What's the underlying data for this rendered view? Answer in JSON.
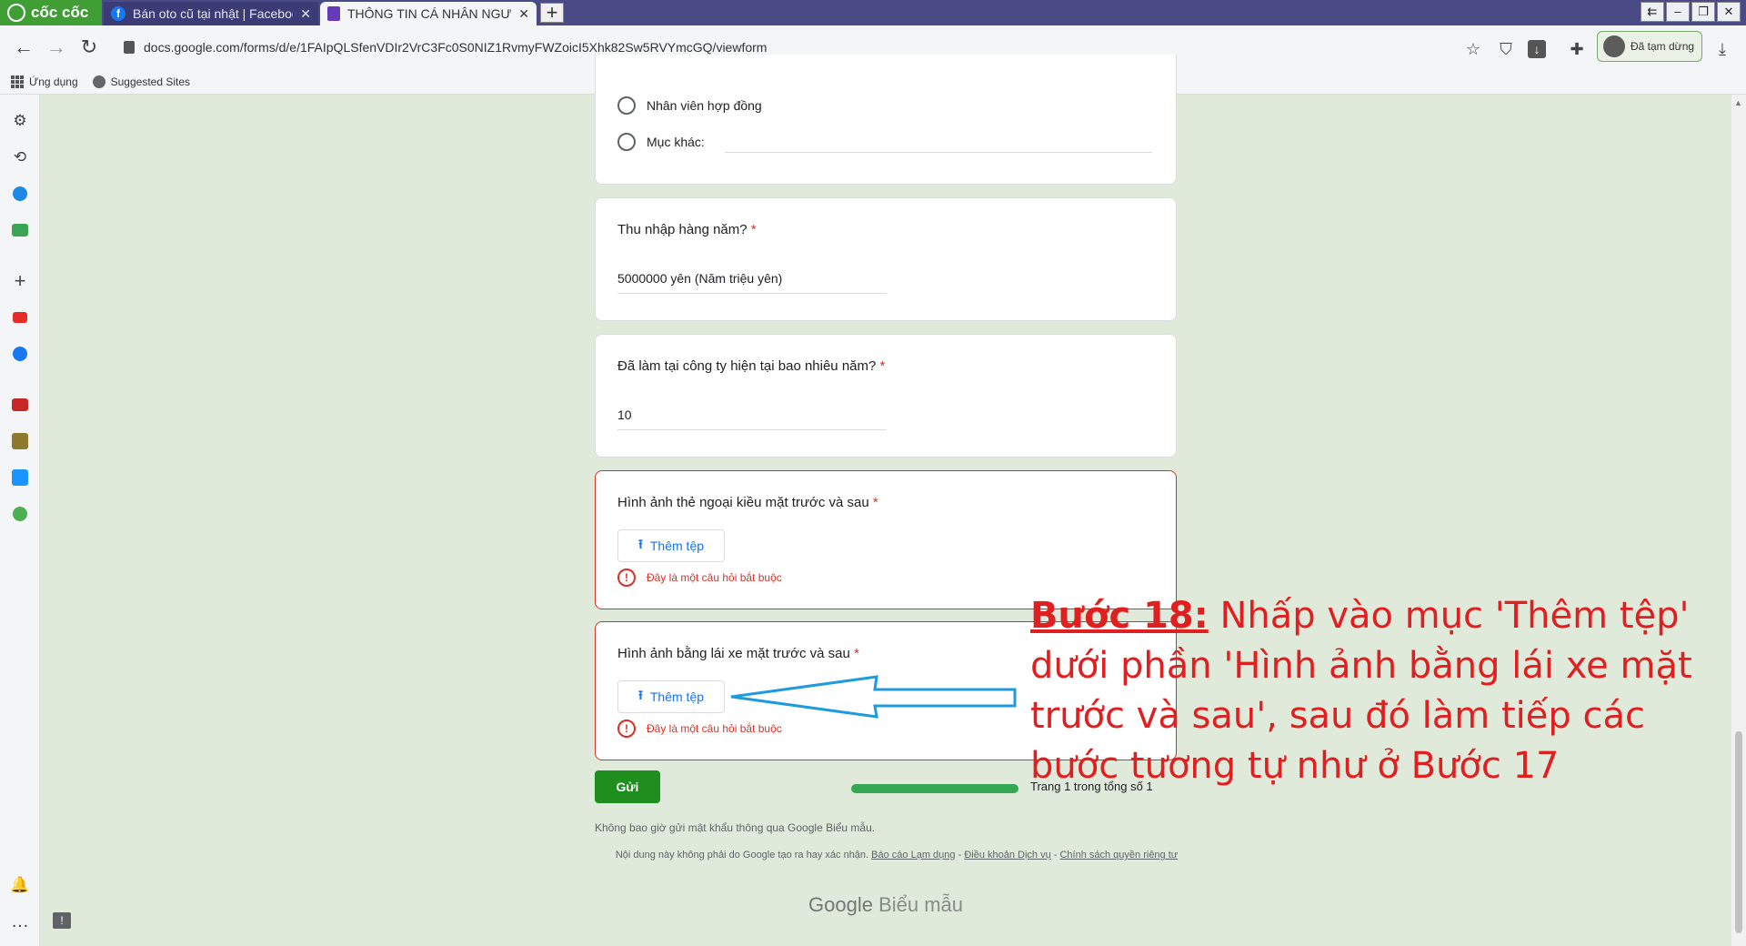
{
  "browser": {
    "logo_text": "cốc cốc",
    "tabs": [
      {
        "title": "Bán oto cũ tại nhật | Facebook"
      },
      {
        "title": "THÔNG TIN CÁ NHÂN NGƯỜI"
      }
    ],
    "new_tab": "+",
    "url": "docs.google.com/forms/d/e/1FAIpQLSfenVDIr2VrC3Fc0S0NIZ1RvmyFWZoicI5Xhk82Sw5RVYmcGQ/viewform",
    "profile_label": "Đã tạm dừng",
    "bookmarks": [
      "Ứng dụng",
      "Suggested Sites"
    ]
  },
  "form": {
    "options": [
      "Nhân viên hợp đồng",
      "Mục khác:"
    ],
    "income": {
      "question": "Thu nhập hàng năm?",
      "answer": "5000000 yên (Năm triệu yên)"
    },
    "years": {
      "question": "Đã làm tại công ty hiện tại bao nhiêu năm?",
      "answer": "10"
    },
    "residence_card": {
      "question": "Hình ảnh thẻ ngoại kiều mặt trước và sau",
      "button": "Thêm tệp",
      "error": "Đây là một câu hỏi bắt buộc"
    },
    "license": {
      "question": "Hình ảnh bằng lái xe mặt trước và sau",
      "button": "Thêm tệp",
      "error": "Đây là một câu hỏi bắt buộc"
    },
    "required_mark": "*",
    "submit": "Gửi",
    "progress": 1.0,
    "page_label": "Trang 1 trong tổng số 1",
    "footer_note": "Không bao giờ gửi mật khẩu thông qua Google Biểu mẫu.",
    "disclaimer": "Nội dung này không phải do Google tạo ra hay xác nhận.",
    "links": [
      "Báo cáo Lạm dụng",
      "Điều khoản Dịch vụ",
      "Chính sách quyền riêng tư"
    ],
    "link_sep": " - ",
    "brand": "Google",
    "brand_product": "Biểu mẫu"
  },
  "annotation": {
    "step": "Bước 18:",
    "text": " Nhấp vào mục 'Thêm tệp' dưới phần 'Hình ảnh bằng lái xe mặt trước và sau', sau đó làm tiếp các bước tương tự như ở Bước 17",
    "color": "#e02020"
  }
}
